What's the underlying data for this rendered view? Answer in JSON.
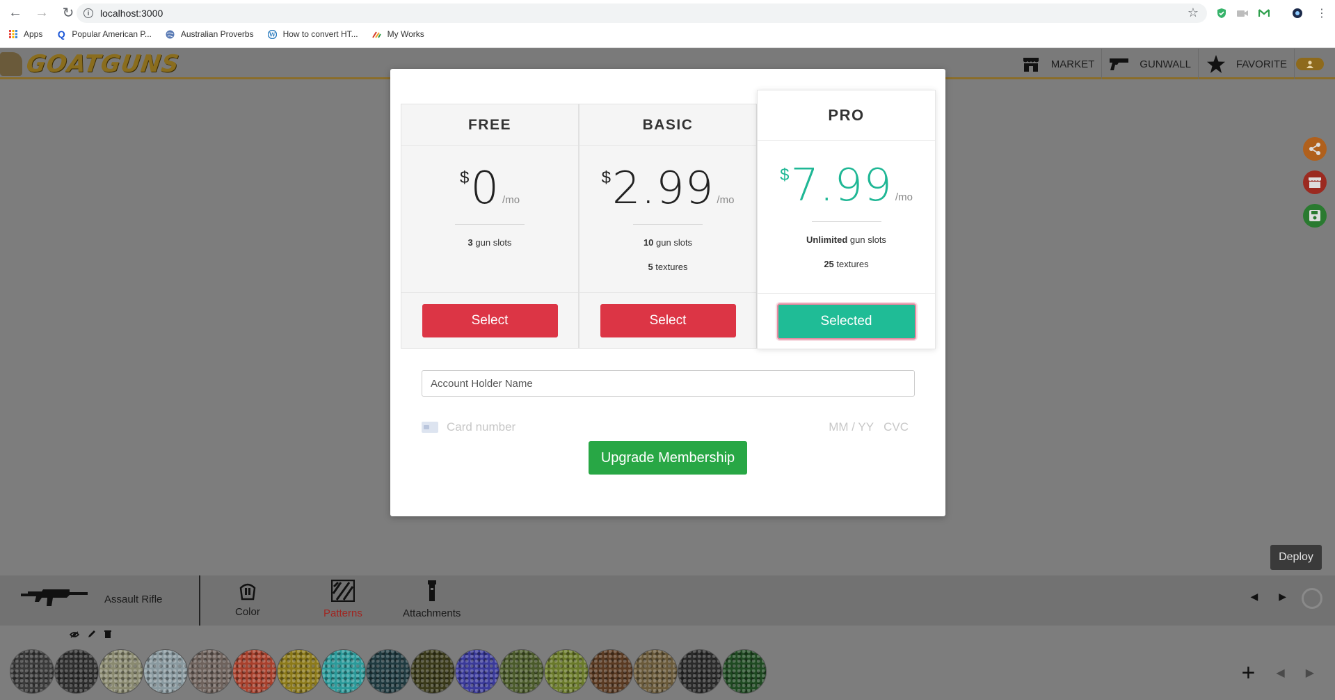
{
  "browser": {
    "url": "localhost:3000",
    "bookmarks": [
      {
        "label": "Apps",
        "icon": "apps-grid-icon",
        "color": "#e44"
      },
      {
        "label": "Popular American P...",
        "icon": "quora-icon",
        "color": "#1a55d6"
      },
      {
        "label": "Australian Proverbs",
        "icon": "globe-icon",
        "color": "#4a6aa0"
      },
      {
        "label": "How to convert HT...",
        "icon": "wordpress-icon",
        "color": "#2d7dbf"
      },
      {
        "label": "My Works",
        "icon": "brush-icon",
        "color": "#d43b2b"
      }
    ]
  },
  "app": {
    "logo": "GOATGUNS",
    "nav": [
      {
        "label": "MARKET",
        "icon": "market-icon"
      },
      {
        "label": "GUNWALL",
        "icon": "pistol-icon"
      },
      {
        "label": "FAVORITE",
        "icon": "star-icon"
      }
    ],
    "deploy_label": "Deploy"
  },
  "toolbar": {
    "weapon_label": "Assault Rifle",
    "tools": [
      {
        "label": "Color",
        "icon": "paint-bucket-icon",
        "active": false
      },
      {
        "label": "Patterns",
        "icon": "patterns-icon",
        "active": true
      },
      {
        "label": "Attachments",
        "icon": "flashlight-icon",
        "active": false
      }
    ]
  },
  "modal": {
    "plans": [
      {
        "name": "FREE",
        "currency": "$",
        "price": "0",
        "period": "/mo",
        "features": [
          {
            "strong": "3",
            "text": " gun slots"
          }
        ],
        "button": "Select",
        "selected": false
      },
      {
        "name": "BASIC",
        "currency": "$",
        "price": "2.99",
        "period": "/mo",
        "features": [
          {
            "strong": "10",
            "text": " gun slots"
          },
          {
            "strong": "5",
            "text": " textures"
          }
        ],
        "button": "Select",
        "selected": false
      },
      {
        "name": "PRO",
        "currency": "$",
        "price": "7.99",
        "period": "/mo",
        "features": [
          {
            "strong": "Unlimited",
            "text": " gun slots"
          },
          {
            "strong": "25",
            "text": " textures"
          }
        ],
        "button": "Selected",
        "selected": true
      }
    ],
    "account_placeholder": "Account Holder Name",
    "card_number_placeholder": "Card number",
    "expiry_placeholder": "MM / YY",
    "cvc_placeholder": "CVC",
    "upgrade_label": "Upgrade Membership"
  },
  "swatches": [
    "#3a3a3a",
    "#2f2f2f",
    "#8a8a70",
    "#8a9aa0",
    "#6e625c",
    "#a8402c",
    "#8c7a1a",
    "#2a9a9a",
    "#1f3a40",
    "#3a3a1a",
    "#3a3a9a",
    "#4a5a2a",
    "#6a7a2a",
    "#5a3a22",
    "#6a5a3a",
    "#2a2a2a",
    "#1f4a22"
  ],
  "colors": {
    "accent_pro": "#1fb795",
    "select_red": "#dc3545",
    "upgrade_green": "#28a745"
  }
}
